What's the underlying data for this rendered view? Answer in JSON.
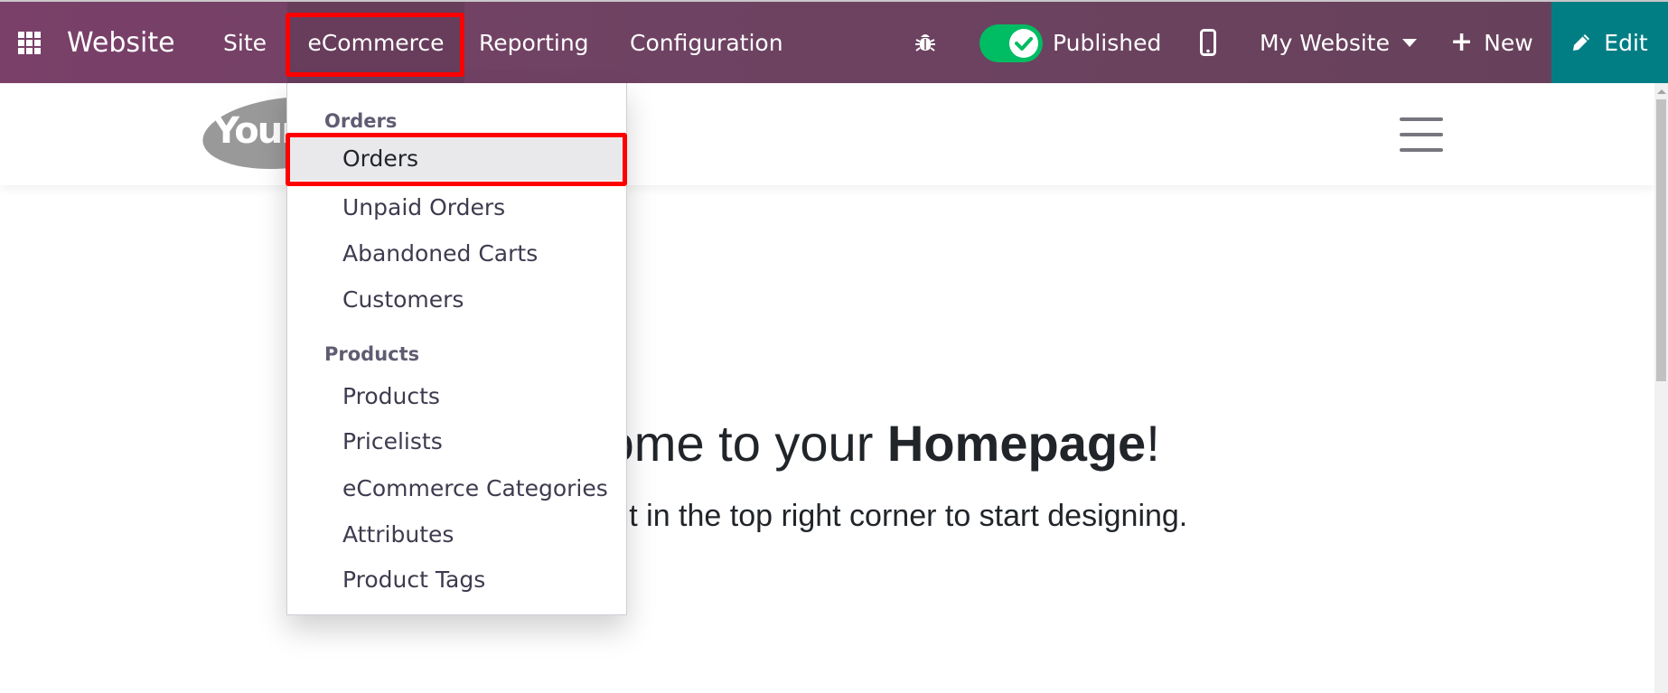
{
  "navbar": {
    "app_name": "Website",
    "menus": {
      "site": "Site",
      "ecommerce": "eCommerce",
      "reporting": "Reporting",
      "configuration": "Configuration"
    },
    "publish_toggle": {
      "state": "on",
      "label": "Published"
    },
    "website_selector": "My Website",
    "new_label": "New",
    "edit_label": "Edit",
    "icons": {
      "apps": "apps-grid-icon",
      "debug": "bug-icon",
      "mobile_preview": "mobile-phone-icon",
      "new": "plus-icon",
      "edit": "pencil-icon"
    },
    "colors": {
      "navbar": "#714B67",
      "edit_button": "#017E84",
      "toggle_on": "#00BC62",
      "highlight": "#FF0000"
    }
  },
  "ecommerce_dropdown": {
    "sections": [
      {
        "header": "Orders",
        "items": [
          "Orders",
          "Unpaid Orders",
          "Abandoned Carts",
          "Customers"
        ]
      },
      {
        "header": "Products",
        "items": [
          "Products",
          "Pricelists",
          "eCommerce Categories",
          "Attributes",
          "Product Tags"
        ]
      }
    ],
    "active_item": "Orders"
  },
  "site": {
    "logo_text": "Your",
    "hero": {
      "title_prefix": "Welcome to your ",
      "title_bold": "Homepage",
      "title_suffix": "!",
      "subtitle": "Click on Edit in the top right corner to start designing."
    }
  }
}
